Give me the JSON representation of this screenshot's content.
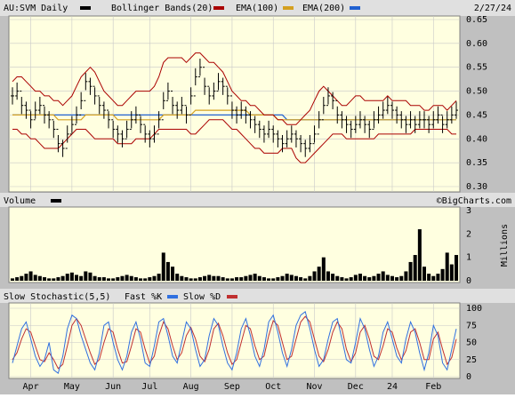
{
  "header": {
    "symbol_label": "AU:SVM Daily",
    "legend": [
      {
        "label": "Bollinger Bands(20)",
        "color": "#000000"
      },
      {
        "label": "EMA(100)",
        "color": "#aa0000"
      },
      {
        "label": "EMA(200)",
        "color": "#d4a020"
      },
      {
        "label": "",
        "color": "#2060d0"
      }
    ],
    "date": "2/27/24",
    "volume_label": "Volume",
    "watermark": "©BigCharts.com",
    "millions_label": "Millions",
    "stoch_label": "Slow Stochastic(5,5)",
    "fast_label": "Fast %K",
    "slow_label": "Slow %D"
  },
  "colors": {
    "price_bars": "#000000",
    "bollinger": "#aa0000",
    "ema100": "#d4a020",
    "ema200": "#2060d0",
    "fast_k": "#3070e0",
    "slow_d": "#c03030",
    "panel": "#ffffe0"
  },
  "chart_data": [
    {
      "type": "ohlc",
      "ylim": [
        0.3,
        0.65
      ],
      "yticks": [
        "0.30",
        "0.35",
        "0.40",
        "0.45",
        "0.50",
        "0.55",
        "0.60",
        "0.65"
      ],
      "x_tick_labels": [
        "Apr",
        "May",
        "Jun",
        "Jul",
        "Aug",
        "Sep",
        "Oct",
        "Nov",
        "Dec",
        "24",
        "Feb"
      ],
      "close": [
        0.49,
        0.5,
        0.47,
        0.46,
        0.44,
        0.46,
        0.47,
        0.45,
        0.44,
        0.42,
        0.39,
        0.38,
        0.41,
        0.43,
        0.45,
        0.48,
        0.52,
        0.51,
        0.49,
        0.47,
        0.46,
        0.44,
        0.42,
        0.41,
        0.4,
        0.42,
        0.44,
        0.45,
        0.43,
        0.41,
        0.4,
        0.41,
        0.44,
        0.48,
        0.5,
        0.47,
        0.46,
        0.47,
        0.45,
        0.49,
        0.53,
        0.55,
        0.51,
        0.49,
        0.5,
        0.52,
        0.51,
        0.49,
        0.46,
        0.45,
        0.46,
        0.45,
        0.44,
        0.43,
        0.42,
        0.41,
        0.42,
        0.41,
        0.4,
        0.39,
        0.4,
        0.41,
        0.4,
        0.39,
        0.38,
        0.39,
        0.41,
        0.44,
        0.47,
        0.49,
        0.48,
        0.45,
        0.44,
        0.43,
        0.42,
        0.43,
        0.44,
        0.43,
        0.42,
        0.44,
        0.45,
        0.46,
        0.47,
        0.46,
        0.45,
        0.44,
        0.43,
        0.44,
        0.43,
        0.44,
        0.44,
        0.43,
        0.44,
        0.45,
        0.43,
        0.44,
        0.45,
        0.46
      ],
      "high_offset": 0.018,
      "low_offset": 0.018,
      "bollinger_upper": [
        0.52,
        0.53,
        0.53,
        0.52,
        0.51,
        0.5,
        0.5,
        0.49,
        0.49,
        0.48,
        0.48,
        0.47,
        0.48,
        0.49,
        0.51,
        0.53,
        0.54,
        0.55,
        0.54,
        0.52,
        0.5,
        0.49,
        0.48,
        0.47,
        0.47,
        0.48,
        0.49,
        0.5,
        0.5,
        0.5,
        0.5,
        0.51,
        0.53,
        0.56,
        0.57,
        0.57,
        0.57,
        0.57,
        0.56,
        0.57,
        0.58,
        0.58,
        0.57,
        0.56,
        0.56,
        0.55,
        0.54,
        0.52,
        0.5,
        0.49,
        0.48,
        0.48,
        0.47,
        0.47,
        0.46,
        0.45,
        0.45,
        0.45,
        0.44,
        0.44,
        0.43,
        0.43,
        0.43,
        0.44,
        0.45,
        0.46,
        0.48,
        0.5,
        0.51,
        0.5,
        0.49,
        0.48,
        0.47,
        0.47,
        0.48,
        0.49,
        0.49,
        0.48,
        0.48,
        0.48,
        0.48,
        0.48,
        0.49,
        0.48,
        0.48,
        0.48,
        0.48,
        0.47,
        0.47,
        0.47,
        0.46,
        0.46,
        0.47,
        0.47,
        0.47,
        0.46,
        0.47,
        0.48
      ],
      "bollinger_lower": [
        0.42,
        0.42,
        0.41,
        0.41,
        0.4,
        0.4,
        0.39,
        0.38,
        0.38,
        0.38,
        0.38,
        0.39,
        0.4,
        0.41,
        0.42,
        0.42,
        0.42,
        0.41,
        0.4,
        0.4,
        0.4,
        0.4,
        0.4,
        0.39,
        0.39,
        0.39,
        0.39,
        0.4,
        0.4,
        0.4,
        0.4,
        0.41,
        0.42,
        0.42,
        0.42,
        0.42,
        0.42,
        0.42,
        0.42,
        0.41,
        0.41,
        0.42,
        0.43,
        0.44,
        0.44,
        0.44,
        0.44,
        0.43,
        0.42,
        0.42,
        0.41,
        0.4,
        0.39,
        0.38,
        0.38,
        0.37,
        0.37,
        0.37,
        0.37,
        0.38,
        0.38,
        0.38,
        0.36,
        0.35,
        0.35,
        0.36,
        0.37,
        0.38,
        0.39,
        0.4,
        0.41,
        0.41,
        0.41,
        0.4,
        0.4,
        0.4,
        0.4,
        0.4,
        0.4,
        0.4,
        0.41,
        0.41,
        0.41,
        0.41,
        0.41,
        0.41,
        0.41,
        0.41,
        0.42,
        0.42,
        0.42,
        0.42,
        0.42,
        0.42,
        0.42,
        0.42,
        0.41,
        0.41
      ],
      "ema100": [
        0.45,
        0.45,
        0.45,
        0.45,
        0.45,
        0.45,
        0.45,
        0.45,
        0.45,
        0.45,
        0.44,
        0.44,
        0.44,
        0.44,
        0.44,
        0.44,
        0.45,
        0.45,
        0.45,
        0.45,
        0.45,
        0.45,
        0.45,
        0.44,
        0.44,
        0.44,
        0.44,
        0.44,
        0.44,
        0.44,
        0.44,
        0.44,
        0.44,
        0.45,
        0.45,
        0.45,
        0.45,
        0.45,
        0.45,
        0.45,
        0.46,
        0.46,
        0.46,
        0.46,
        0.46,
        0.46,
        0.46,
        0.46,
        0.46,
        0.46,
        0.46,
        0.46,
        0.45,
        0.45,
        0.45,
        0.45,
        0.45,
        0.45,
        0.44,
        0.44,
        0.44,
        0.44,
        0.44,
        0.44,
        0.44,
        0.44,
        0.44,
        0.44,
        0.44,
        0.44,
        0.44,
        0.44,
        0.44,
        0.44,
        0.44,
        0.44,
        0.44,
        0.44,
        0.44,
        0.44,
        0.44,
        0.44,
        0.44,
        0.44,
        0.44,
        0.44,
        0.44,
        0.44,
        0.44,
        0.44,
        0.44,
        0.44,
        0.44,
        0.44,
        0.44,
        0.44,
        0.44,
        0.44
      ],
      "ema200": [
        0.45,
        0.45,
        0.45,
        0.45,
        0.45,
        0.45,
        0.45,
        0.45,
        0.45,
        0.45,
        0.45,
        0.45,
        0.45,
        0.45,
        0.45,
        0.45,
        0.45,
        0.45,
        0.45,
        0.45,
        0.45,
        0.45,
        0.45,
        0.45,
        0.45,
        0.45,
        0.45,
        0.45,
        0.45,
        0.45,
        0.45,
        0.45,
        0.45,
        0.45,
        0.45,
        0.45,
        0.45,
        0.45,
        0.45,
        0.45,
        0.45,
        0.45,
        0.45,
        0.45,
        0.45,
        0.45,
        0.45,
        0.45,
        0.45,
        0.45,
        0.45,
        0.45,
        0.45,
        0.45,
        0.45,
        0.45,
        0.45,
        0.45,
        0.45,
        0.45,
        0.44,
        0.44,
        0.44,
        0.44,
        0.44,
        0.44,
        0.44,
        0.44,
        0.44,
        0.44,
        0.44,
        0.44,
        0.44,
        0.44,
        0.44,
        0.44,
        0.44,
        0.44,
        0.44,
        0.44,
        0.44,
        0.44,
        0.44,
        0.44,
        0.44,
        0.44,
        0.44,
        0.44,
        0.44,
        0.44,
        0.44,
        0.44,
        0.44,
        0.44,
        0.44,
        0.44,
        0.44,
        0.44
      ]
    },
    {
      "type": "bar",
      "name": "Volume",
      "ylim": [
        0,
        3
      ],
      "yticks": [
        "0",
        "1",
        "2",
        "3"
      ],
      "unit": "Millions",
      "values": [
        0.1,
        0.15,
        0.2,
        0.3,
        0.4,
        0.25,
        0.2,
        0.15,
        0.1,
        0.1,
        0.15,
        0.2,
        0.3,
        0.35,
        0.25,
        0.2,
        0.4,
        0.35,
        0.2,
        0.15,
        0.15,
        0.1,
        0.1,
        0.15,
        0.2,
        0.25,
        0.2,
        0.15,
        0.1,
        0.1,
        0.15,
        0.2,
        0.3,
        1.2,
        0.8,
        0.6,
        0.3,
        0.2,
        0.15,
        0.1,
        0.1,
        0.15,
        0.2,
        0.25,
        0.2,
        0.2,
        0.15,
        0.1,
        0.1,
        0.15,
        0.15,
        0.2,
        0.25,
        0.3,
        0.2,
        0.15,
        0.1,
        0.1,
        0.15,
        0.2,
        0.3,
        0.25,
        0.2,
        0.15,
        0.1,
        0.2,
        0.4,
        0.6,
        1.0,
        0.4,
        0.3,
        0.2,
        0.15,
        0.1,
        0.15,
        0.25,
        0.3,
        0.2,
        0.15,
        0.2,
        0.3,
        0.4,
        0.25,
        0.2,
        0.15,
        0.2,
        0.4,
        0.8,
        1.1,
        2.2,
        0.6,
        0.3,
        0.2,
        0.3,
        0.5,
        1.2,
        0.7,
        1.1
      ]
    },
    {
      "type": "line",
      "name": "Slow Stochastic(5,5)",
      "ylim": [
        0,
        100
      ],
      "yticks": [
        "0",
        "25",
        "50",
        "75",
        "100"
      ],
      "series": [
        {
          "name": "Fast %K",
          "values": [
            20,
            45,
            70,
            80,
            55,
            30,
            15,
            25,
            50,
            10,
            5,
            30,
            70,
            90,
            85,
            60,
            40,
            20,
            10,
            35,
            75,
            80,
            50,
            25,
            10,
            30,
            65,
            80,
            55,
            20,
            15,
            45,
            80,
            85,
            60,
            30,
            20,
            50,
            80,
            70,
            40,
            15,
            25,
            60,
            85,
            75,
            45,
            20,
            10,
            35,
            70,
            85,
            60,
            30,
            15,
            40,
            80,
            90,
            65,
            35,
            15,
            40,
            75,
            90,
            95,
            70,
            40,
            15,
            25,
            55,
            80,
            85,
            55,
            25,
            20,
            50,
            85,
            70,
            40,
            15,
            30,
            65,
            80,
            55,
            30,
            20,
            55,
            80,
            65,
            35,
            10,
            35,
            75,
            60,
            20,
            10,
            40,
            70
          ]
        },
        {
          "name": "Slow %D",
          "values": [
            25,
            35,
            55,
            70,
            65,
            45,
            25,
            22,
            35,
            25,
            12,
            18,
            45,
            75,
            85,
            75,
            55,
            35,
            18,
            25,
            50,
            70,
            65,
            40,
            20,
            22,
            45,
            70,
            65,
            40,
            20,
            30,
            60,
            80,
            70,
            45,
            25,
            35,
            60,
            72,
            55,
            30,
            22,
            40,
            70,
            78,
            60,
            35,
            18,
            25,
            50,
            75,
            70,
            45,
            25,
            30,
            60,
            82,
            75,
            50,
            25,
            30,
            55,
            80,
            88,
            80,
            55,
            30,
            22,
            40,
            65,
            80,
            70,
            40,
            22,
            35,
            65,
            75,
            55,
            30,
            25,
            45,
            70,
            65,
            42,
            25,
            38,
            65,
            70,
            50,
            25,
            25,
            55,
            65,
            40,
            18,
            28,
            55
          ]
        }
      ]
    }
  ]
}
